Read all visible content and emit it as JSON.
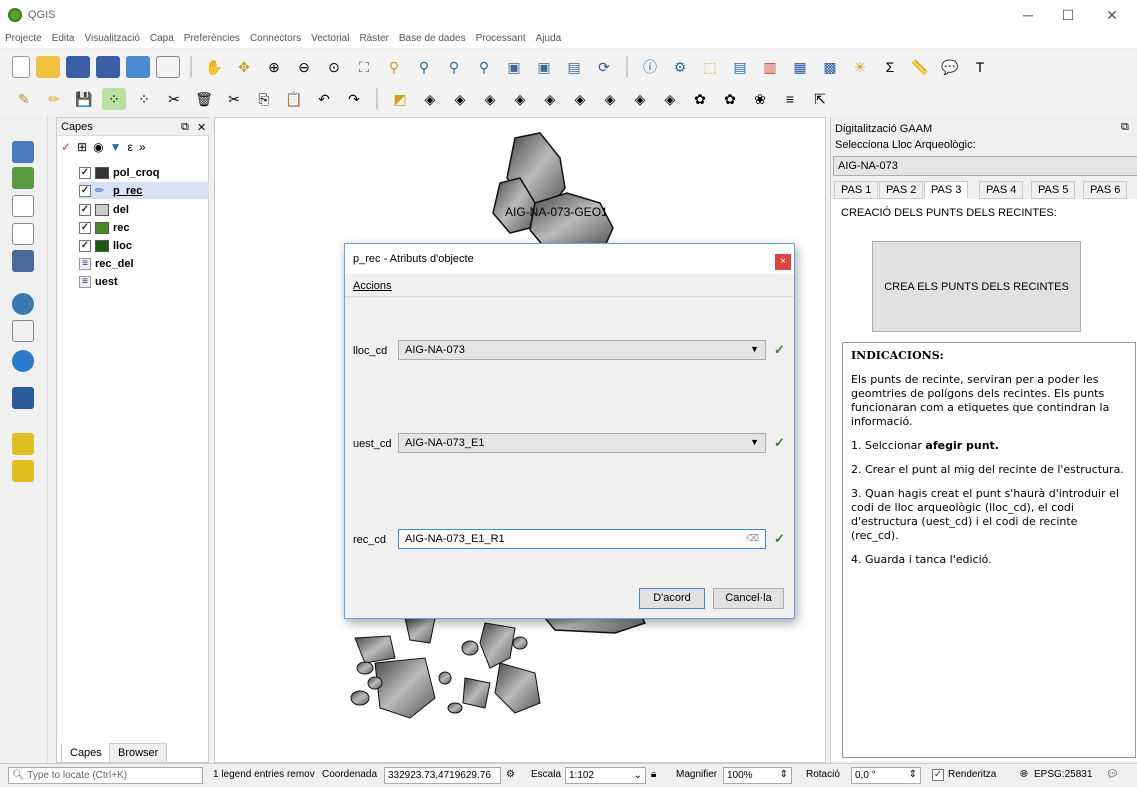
{
  "app": {
    "title": "QGIS"
  },
  "menu": [
    "Projecte",
    "Edita",
    "Visualització",
    "Capa",
    "Preferències",
    "Connectors",
    "Vectorial",
    "Ràster",
    "Base de dades",
    "Processant",
    "Ajuda"
  ],
  "layers_panel": {
    "title": "Capes",
    "items": [
      {
        "name": "pol_croq",
        "checked": true,
        "color": "#333333"
      },
      {
        "name": "p_rec",
        "checked": true,
        "color": ""
      },
      {
        "name": "del",
        "checked": true,
        "color": "#cccccc"
      },
      {
        "name": "rec",
        "checked": true,
        "color": "#4a8a2a"
      },
      {
        "name": "lloc",
        "checked": true,
        "color": "#1f5a10"
      },
      {
        "name": "rec_del",
        "checked": false,
        "color": ""
      },
      {
        "name": "uest",
        "checked": false,
        "color": ""
      }
    ],
    "tabs": [
      "Capes",
      "Browser"
    ]
  },
  "map": {
    "label": "AIG-NA-073-GEO1"
  },
  "right_panel": {
    "title": "Digitalització GAAM",
    "select_label": "Selecciona Lloc Arqueològic:",
    "select_value": "AIG-NA-073",
    "tabs": [
      "PAS 1",
      "PAS 2",
      "PAS 3",
      "PAS 4",
      "PAS 5",
      "PAS 6"
    ],
    "section_title": "CREACIÓ DELS PUNTS DELS RECINTES:",
    "action_button": "CREA ELS PUNTS DELS RECINTES",
    "indicacions": {
      "title": "INDICACIONS:",
      "intro": "Els punts de recinte, serviran per a poder les geomtries de polígons dels recintes. Els punts funcionaran com a etiquetes que contindran la informació.",
      "step1_pre": "1. Selccionar ",
      "step1_bold": "afegir punt.",
      "step2": "2. Crear el punt al mig del recinte de l'estructura.",
      "step3": "3. Quan hagis creat el punt s'haurà d'introduir el codi de lloc arqueològic (lloc_cd), el codi d'estructura (uest_cd) i el codi de recinte (rec_cd).",
      "step4": "4. Guarda i tanca l'edició."
    }
  },
  "dialog": {
    "title": "p_rec - Atributs d'objecte",
    "menu": "Accions",
    "fields": [
      {
        "label": "lloc_cd",
        "value": "AIG-NA-073"
      },
      {
        "label": "uest_cd",
        "value": "AIG-NA-073_E1"
      },
      {
        "label": "rec_cd",
        "value": "AIG-NA-073_E1_R1"
      }
    ],
    "ok": "D'acord",
    "cancel": "Cancel·la"
  },
  "statusbar": {
    "search_placeholder": "Type to locate (Ctrl+K)",
    "message": "1 legend entries remov",
    "coord_label": "Coordenada",
    "coord_value": "332923.73,4719629.76",
    "scale_label": "Escala",
    "scale_value": "1:102",
    "magnifier_label": "Magnifier",
    "magnifier_value": "100%",
    "rotation_label": "Rotació",
    "rotation_value": "0,0 °",
    "render_label": "Renderitza",
    "crs": "EPSG:25831"
  }
}
